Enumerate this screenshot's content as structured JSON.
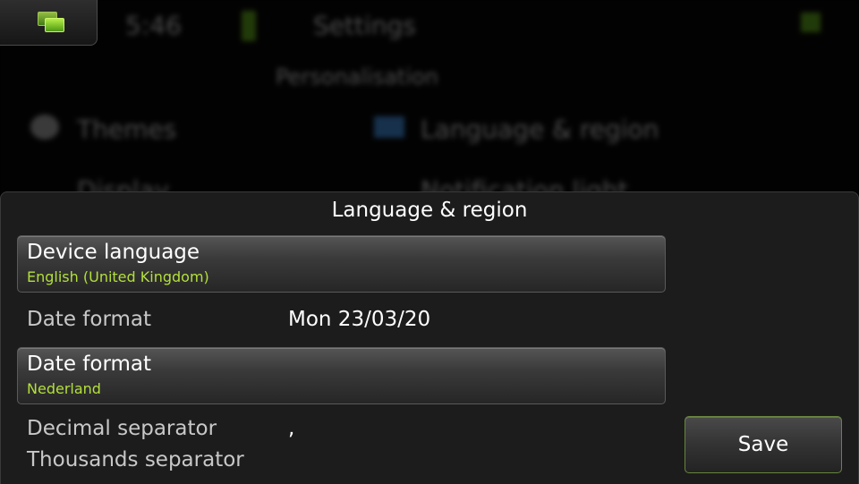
{
  "background": {
    "clock": "5:46",
    "title": "Settings",
    "section": "Personalisation",
    "items": [
      "Themes",
      "Language & region",
      "Display",
      "Notification light"
    ]
  },
  "task_switcher_icon": "task-switcher-icon",
  "dialog": {
    "title": "Language & region",
    "device_language": {
      "label": "Device language",
      "value": "English (United Kingdom)"
    },
    "date_format_row": {
      "label": "Date format",
      "value": "Mon 23/03/20"
    },
    "date_format_picker": {
      "label": "Date format",
      "value": "Nederland"
    },
    "decimal_separator": {
      "label": "Decimal separator",
      "value": ","
    },
    "thousands_separator": {
      "label": "Thousands separator",
      "value": ""
    },
    "save_label": "Save"
  },
  "colors": {
    "accent": "#b3e03a",
    "sheet": "#1c1c1c"
  }
}
